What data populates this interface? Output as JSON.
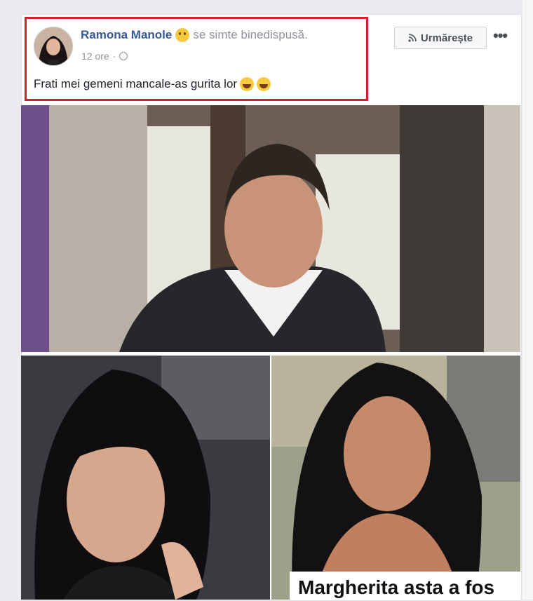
{
  "post": {
    "author": "Ramona Manole",
    "feeling": "se simte binedispusă.",
    "timestamp": "12 ore",
    "text": "Frati mei gemeni mancale-as gurita lor",
    "follow_label": "Urmărește",
    "more_label": "•••"
  },
  "photos": {
    "caption": "Margherita asta a fos"
  },
  "icons": {
    "feeling": "smile-emoji-icon",
    "privacy": "globe-icon",
    "follow": "rss-icon",
    "laugh": "laughing-emoji-icon"
  },
  "colors": {
    "author": "#365899",
    "highlight": "#d3202f",
    "meta": "#90949c"
  }
}
